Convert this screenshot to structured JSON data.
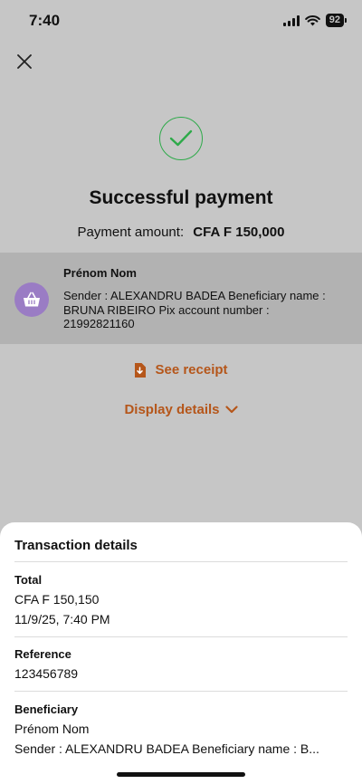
{
  "status_bar": {
    "time": "7:40",
    "battery": "92"
  },
  "payment": {
    "title": "Successful payment",
    "amount_label": "Payment amount:",
    "amount_value": "CFA F 150,000"
  },
  "recipient": {
    "name": "Prénom Nom",
    "description": "Sender : ALEXANDRU BADEA  Beneficiary name : BRUNA RIBEIRO Pix account number : 21992821160"
  },
  "actions": {
    "receipt_label": "See receipt",
    "details_label": "Display details"
  },
  "sheet": {
    "title": "Transaction details",
    "total": {
      "label": "Total",
      "amount": "CFA F 150,150",
      "datetime": "11/9/25, 7:40 PM"
    },
    "reference": {
      "label": "Reference",
      "value": "123456789"
    },
    "beneficiary": {
      "label": "Beneficiary",
      "name": "Prénom Nom",
      "description": "Sender : ALEXANDRU BADEA  Beneficiary name : B..."
    }
  },
  "colors": {
    "accent": "#b5561a",
    "success": "#2eaa4a",
    "avatar": "#9a7cc4",
    "overlay": "#c6c6c6"
  }
}
